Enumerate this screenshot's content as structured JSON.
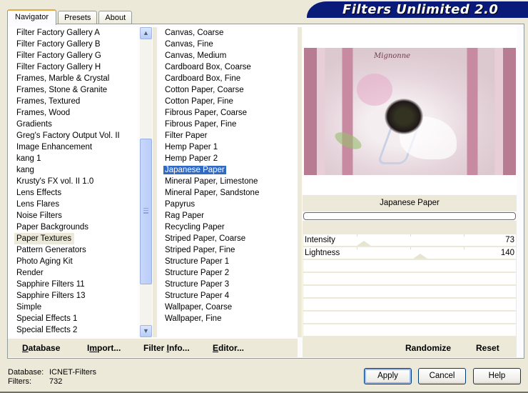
{
  "app": {
    "title": "Filters Unlimited 2.0"
  },
  "tabs": [
    {
      "label": "Navigator",
      "active": true
    },
    {
      "label": "Presets",
      "active": false
    },
    {
      "label": "About",
      "active": false
    }
  ],
  "categories": {
    "selected": "Paper Textures",
    "items": [
      "Filter Factory Gallery A",
      "Filter Factory Gallery B",
      "Filter Factory Gallery G",
      "Filter Factory Gallery H",
      "Frames, Marble & Crystal",
      "Frames, Stone & Granite",
      "Frames, Textured",
      "Frames, Wood",
      "Gradients",
      "Greg's Factory Output Vol. II",
      "Image Enhancement",
      "kang 1",
      "kang",
      "Krusty's FX vol. II 1.0",
      "Lens Effects",
      "Lens Flares",
      "Noise Filters",
      "Paper Backgrounds",
      "Paper Textures",
      "Pattern Generators",
      "Photo Aging Kit",
      "Render",
      "Sapphire Filters 11",
      "Sapphire Filters 13",
      "Simple",
      "Special Effects 1",
      "Special Effects 2"
    ]
  },
  "filters": {
    "selected": "Japanese Paper",
    "items": [
      "Canvas, Coarse",
      "Canvas, Fine",
      "Canvas, Medium",
      "Cardboard Box, Coarse",
      "Cardboard Box, Fine",
      "Cotton Paper, Coarse",
      "Cotton Paper, Fine",
      "Fibrous Paper, Coarse",
      "Fibrous Paper, Fine",
      "Filter Paper",
      "Hemp Paper 1",
      "Hemp Paper 2",
      "Japanese Paper",
      "Mineral Paper, Limestone",
      "Mineral Paper, Sandstone",
      "Papyrus",
      "Rag Paper",
      "Recycling Paper",
      "Striped Paper, Coarse",
      "Striped Paper, Fine",
      "Structure Paper 1",
      "Structure Paper 2",
      "Structure Paper 3",
      "Structure Paper 4",
      "Wallpaper, Coarse",
      "Wallpaper, Fine"
    ]
  },
  "preview": {
    "caption": "Mignonne",
    "filter_name": "Japanese Paper",
    "progress_percent": 0
  },
  "params": [
    {
      "label": "Intensity",
      "value": "73",
      "fraction": 0.286
    },
    {
      "label": "Lightness",
      "value": "140",
      "fraction": 0.549
    }
  ],
  "left_actions": {
    "database": {
      "pre": "",
      "u": "D",
      "post": "atabase"
    },
    "import": {
      "pre": "I",
      "u": "m",
      "post": "port..."
    },
    "filter_info": {
      "pre": "Filter ",
      "u": "I",
      "post": "nfo..."
    },
    "editor": {
      "pre": "",
      "u": "E",
      "post": "ditor..."
    }
  },
  "right_actions": {
    "randomize": "Randomize",
    "reset": "Reset"
  },
  "status": {
    "database_label": "Database:",
    "database_value": "ICNET-Filters",
    "filters_label": "Filters:",
    "filters_value": "732"
  },
  "buttons": {
    "apply": "Apply",
    "cancel": "Cancel",
    "help": "Help"
  }
}
